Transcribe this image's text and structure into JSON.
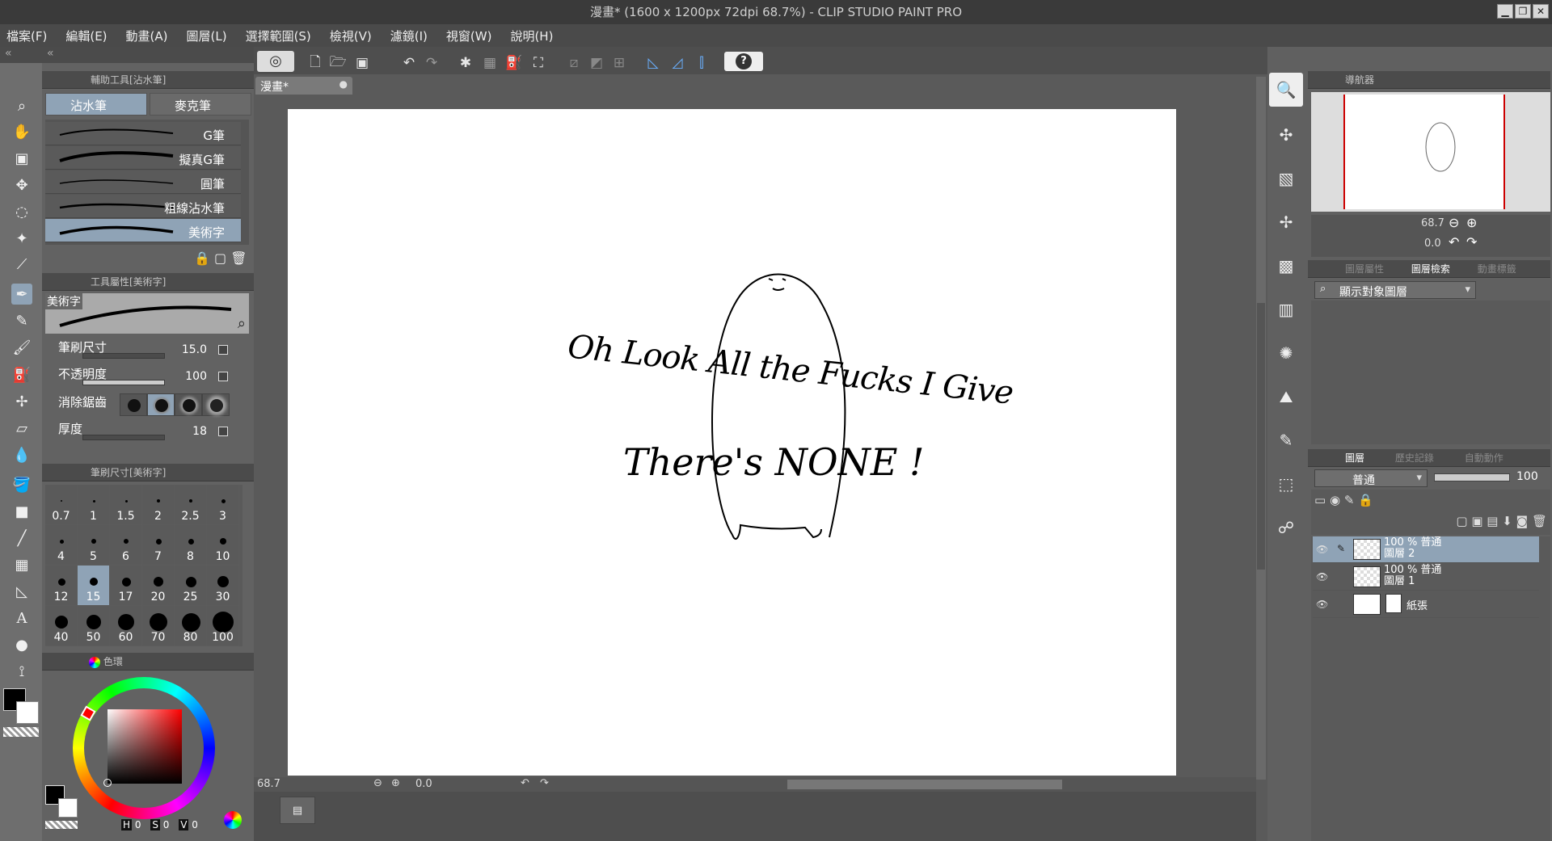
{
  "window": {
    "title": "漫畫* (1600 x 1200px 72dpi 68.7%)  - CLIP STUDIO PAINT PRO",
    "min": "▁",
    "max": "❐",
    "close": "✕"
  },
  "menu": [
    "檔案(F)",
    "編輯(E)",
    "動畫(A)",
    "圖層(L)",
    "選擇範圍(S)",
    "檢視(V)",
    "濾鏡(I)",
    "視窗(W)",
    "說明(H)"
  ],
  "subtool": {
    "header": "輔助工具[沾水筆]",
    "tabs": [
      "沾水筆",
      "麥克筆"
    ],
    "brushes": [
      "G筆",
      "擬真G筆",
      "圓筆",
      "粗線沾水筆",
      "美術字"
    ],
    "selected": 4
  },
  "toolprop": {
    "header": "工具屬性[美術字]",
    "preview_label": "美術字",
    "size_label": "筆刷尺寸",
    "size_value": "15.0",
    "opacity_label": "不透明度",
    "opacity_value": "100",
    "aa_label": "消除鋸齒",
    "thick_label": "厚度",
    "thick_value": "18"
  },
  "brushsize": {
    "header": "筆刷尺寸[美術字]",
    "values": [
      "0.7",
      "1",
      "1.5",
      "2",
      "2.5",
      "3",
      "4",
      "5",
      "6",
      "7",
      "8",
      "10",
      "12",
      "15",
      "17",
      "20",
      "25",
      "30",
      "40",
      "50",
      "60",
      "70",
      "80",
      "100"
    ],
    "selected": "15"
  },
  "color": {
    "tab": "色環",
    "fg": "#000000",
    "bg": "#ffffff",
    "h_label": "H",
    "h": "0",
    "s_label": "S",
    "s": "0",
    "v_label": "V",
    "v": "0"
  },
  "doc": {
    "tab": "漫畫*",
    "zoom": "68.7",
    "angle": "0.0"
  },
  "canvas": {
    "line1": "Oh Look All the Fucks I Give",
    "line2": "There's NONE !"
  },
  "navigator": {
    "tab": "導航器",
    "zoom": "68.7",
    "angle": "0.0"
  },
  "layerprop": {
    "tab1": "圖層屬性",
    "tab2": "圖層檢索",
    "tab3": "動畫標籤",
    "search": "顯示對象圖層"
  },
  "layers": {
    "tab1": "圖層",
    "tab2": "歷史記錄",
    "tab3": "自動動作",
    "blend": "普通",
    "opacity": "100",
    "items": [
      {
        "line1": "100 % 普通",
        "line2": "圖層 2",
        "sel": true
      },
      {
        "line1": "100 % 普通",
        "line2": "圖層 1",
        "sel": false
      },
      {
        "line1": "",
        "line2": "紙張",
        "sel": false
      }
    ]
  },
  "icons": {
    "undo": "↶",
    "redo": "↷",
    "help": "?",
    "zoom": "🔍"
  }
}
